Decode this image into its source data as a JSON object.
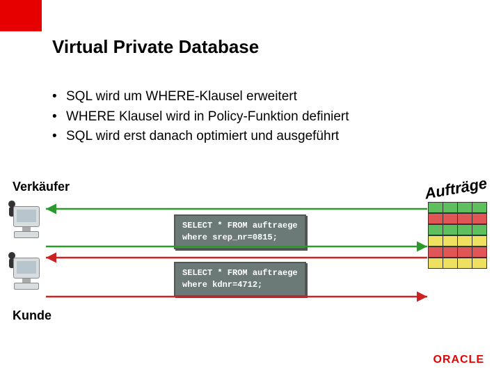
{
  "title": "Virtual Private Database",
  "bullets": [
    "SQL wird um WHERE-Klausel erweitert",
    "WHERE Klausel wird in Policy-Funktion definiert",
    "SQL wird erst danach optimiert und ausgeführt"
  ],
  "labels": {
    "verkaufer": "Verkäufer",
    "kunde": "Kunde",
    "auftrage": "Aufträge"
  },
  "sql": {
    "q1_line1": "SELECT * FROM auftraege",
    "q1_line2": "where srep_nr=0815;",
    "q2_line1": "SELECT * FROM auftraege",
    "q2_line2": "where kdnr=4712;"
  },
  "logo": "ORACLE"
}
